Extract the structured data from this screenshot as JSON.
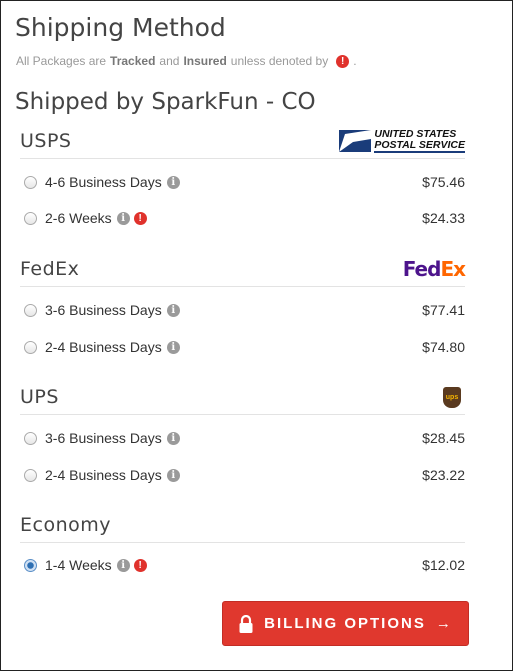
{
  "header": {
    "title": "Shipping Method",
    "note_prefix": "All Packages are",
    "note_tracked": "Tracked",
    "note_and": "and",
    "note_insured": "Insured",
    "note_suffix": "unless denoted by",
    "note_end": "."
  },
  "shipped_by": "Shipped by SparkFun - CO",
  "carriers": [
    {
      "name": "USPS",
      "logo_text_1": "UNITED STATES",
      "logo_text_2": "POSTAL SERVICE",
      "options": [
        {
          "label": "4-6 Business Days",
          "price": "$75.46",
          "checked": false,
          "warning": false
        },
        {
          "label": "2-6 Weeks",
          "price": "$24.33",
          "checked": false,
          "warning": true
        }
      ]
    },
    {
      "name": "FedEx",
      "logo_fe": "Fed",
      "logo_ex": "Ex",
      "options": [
        {
          "label": "3-6 Business Days",
          "price": "$77.41",
          "checked": false,
          "warning": false
        },
        {
          "label": "2-4 Business Days",
          "price": "$74.80",
          "checked": false,
          "warning": false
        }
      ]
    },
    {
      "name": "UPS",
      "logo_text": "ups",
      "options": [
        {
          "label": "3-6 Business Days",
          "price": "$28.45",
          "checked": false,
          "warning": false
        },
        {
          "label": "2-4 Business Days",
          "price": "$23.22",
          "checked": false,
          "warning": false
        }
      ]
    },
    {
      "name": "Economy",
      "options": [
        {
          "label": "1-4 Weeks",
          "price": "$12.02",
          "checked": true,
          "warning": true
        }
      ]
    }
  ],
  "icons": {
    "info": "i",
    "warning": "!"
  },
  "billing_button": {
    "label": "BILLING OPTIONS",
    "arrow": "→"
  },
  "colors": {
    "accent_red": "#e0382e",
    "usps_blue": "#1a3c7a",
    "fedex_purple": "#4d148c",
    "fedex_orange": "#ff6600",
    "ups_brown": "#5a3a1f",
    "ups_gold": "#f5b400"
  }
}
